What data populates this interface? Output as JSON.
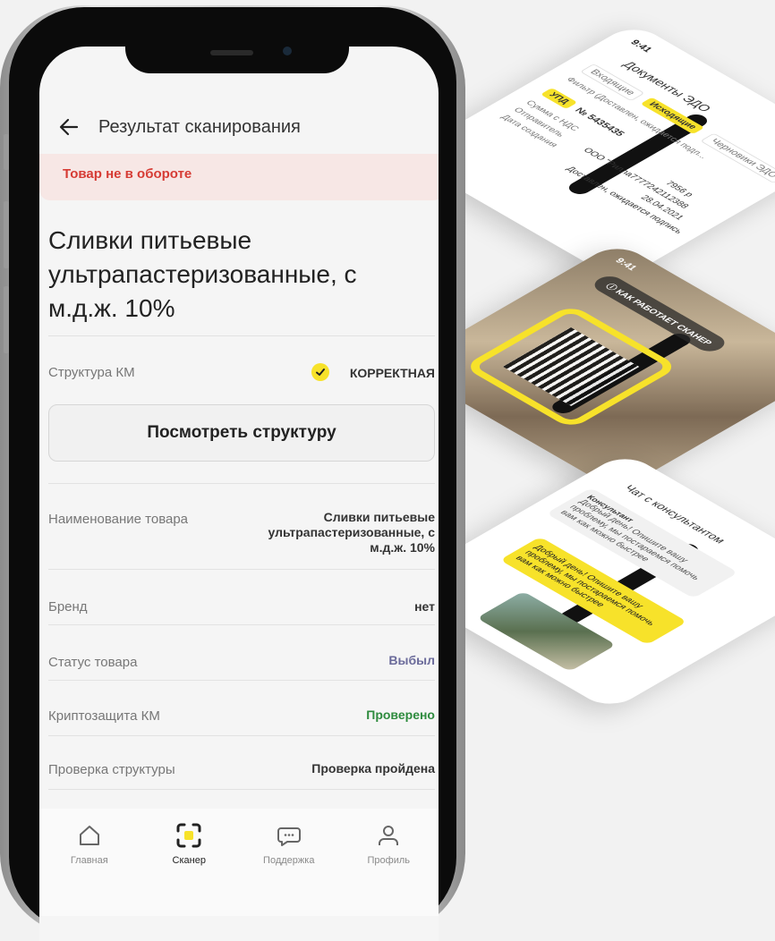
{
  "header": {
    "title": "Результат сканирования"
  },
  "alert": {
    "text": "Товар не в обороте"
  },
  "product": {
    "title": "Сливки питьевые ультрапастеризованные, с м.д.ж. 10%"
  },
  "structure": {
    "label": "Структура КМ",
    "status": "КОРРЕКТНАЯ",
    "button_label": "Посмотреть структуру"
  },
  "details": [
    {
      "label": "Наименование товара",
      "value": "Сливки питьевые ультрапастеризованные, с м.д.ж. 10%",
      "color": "#333333"
    },
    {
      "label": "Бренд",
      "value": "нет",
      "color": "#333333"
    },
    {
      "label": "Статус товара",
      "value": "Выбыл",
      "color": "#6a6a9a"
    },
    {
      "label": "Криптозащита КМ",
      "value": "Проверено",
      "color": "#2e8b3e"
    },
    {
      "label": "Проверка структуры",
      "value": "Проверка пройдена",
      "color": "#333333"
    }
  ],
  "tabbar": {
    "items": [
      {
        "label": "Главная",
        "icon": "home-icon",
        "active": false
      },
      {
        "label": "Сканер",
        "icon": "scanner-icon",
        "active": true
      },
      {
        "label": "Поддержка",
        "icon": "chat-icon",
        "active": false
      },
      {
        "label": "Профиль",
        "icon": "profile-icon",
        "active": false
      }
    ]
  },
  "bg_screens": {
    "edo": {
      "time": "9:41",
      "title": "Документы ЭДО",
      "tabs": [
        "Входящие",
        "Исходящие",
        "Черновики ЭДО"
      ],
      "filter": "Фильтр (Доставлен, ожидается подп...",
      "doc_type": "УПД",
      "doc_number": "№ 5435435",
      "sum_label": "Сумма с НДС",
      "sender_label": "Отправитель",
      "date_label": "Дата создания",
      "sum": "7956 р",
      "sender": "ООО \"Рилла7777242112388",
      "date": "28.04.2021",
      "status": "Доставлен, ожидается подпись"
    },
    "scanner": {
      "time": "9:41",
      "hint": "КАК РАБОТАЕТ СКАНЕР"
    },
    "chat": {
      "title": "Чат с консультантом",
      "consultant_label": "Консультант",
      "greeting": "Добрый день! Опишите вашу проблему, мы постараемся помочь вам как можно быстрее"
    }
  },
  "colors": {
    "accent": "#f7e22a",
    "alert_bg": "#f7e7e5",
    "alert_text": "#d63b34"
  }
}
